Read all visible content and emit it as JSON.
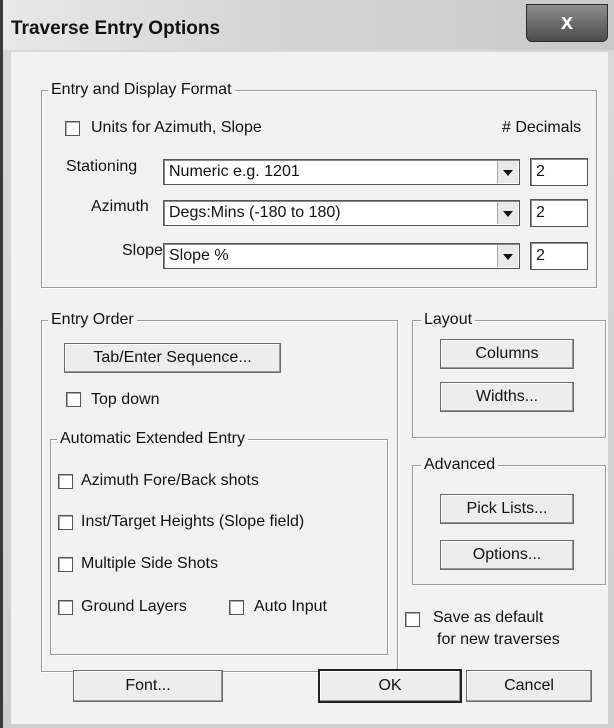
{
  "window": {
    "title": "Traverse Entry Options",
    "close_label": "x"
  },
  "entry_display": {
    "legend": "Entry and Display Format",
    "units_checkbox_label": "Units for Azimuth, Slope",
    "decimals_label": "# Decimals",
    "rows": [
      {
        "label": "Stationing",
        "value": "Numeric e.g. 1201",
        "decimals": "2"
      },
      {
        "label": "Azimuth",
        "value": "Degs:Mins (-180 to 180)",
        "decimals": "2"
      },
      {
        "label": "Slope",
        "value": "Slope %",
        "decimals": "2"
      }
    ]
  },
  "entry_order": {
    "legend": "Entry Order",
    "sequence_button": "Tab/Enter Sequence...",
    "top_down_label": "Top down"
  },
  "auto_extended": {
    "legend": "Automatic Extended Entry",
    "azimuth_fore_back": "Azimuth Fore/Back shots",
    "inst_target_heights": "Inst/Target Heights (Slope field)",
    "multiple_side_shots": "Multiple Side Shots",
    "ground_layers": "Ground Layers",
    "auto_input": "Auto Input"
  },
  "layout_group": {
    "legend": "Layout",
    "columns_button": "Columns",
    "widths_button": "Widths..."
  },
  "advanced_group": {
    "legend": "Advanced",
    "pick_lists_button": "Pick Lists...",
    "options_button": "Options..."
  },
  "save_default": {
    "line1": "Save as default",
    "line2": "for new traverses"
  },
  "footer": {
    "font_button": "Font...",
    "ok_button": "OK",
    "cancel_button": "Cancel"
  }
}
